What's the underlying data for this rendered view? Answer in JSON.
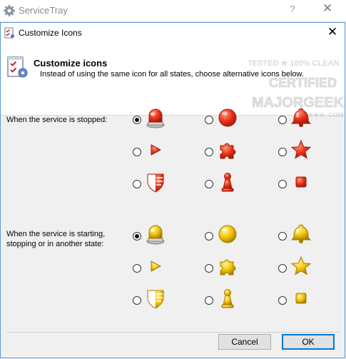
{
  "parent_window": {
    "title": "ServiceTray",
    "help_label": "?",
    "close_label": "✕"
  },
  "dialog": {
    "title": "Customize Icons",
    "close_label": "✕",
    "header": {
      "title": "Customize icons",
      "description": "Instead of using the same icon for all states, choose alternative icons below."
    },
    "groups": [
      {
        "label_lines": [
          "When the service is stopped:"
        ],
        "color": "red",
        "options": [
          {
            "icon": "beacon-light-icon",
            "selected": true
          },
          {
            "icon": "circle-icon",
            "selected": false
          },
          {
            "icon": "bell-icon",
            "selected": false
          },
          {
            "icon": "play-triangle-icon",
            "selected": false
          },
          {
            "icon": "puzzle-piece-icon",
            "selected": false
          },
          {
            "icon": "star-icon",
            "selected": false
          },
          {
            "icon": "shield-icon",
            "selected": false
          },
          {
            "icon": "pawn-icon",
            "selected": false
          },
          {
            "icon": "square-icon",
            "selected": false
          }
        ]
      },
      {
        "label_lines": [
          "When the service is starting,",
          "stopping or in another state:"
        ],
        "color": "yellow",
        "options": [
          {
            "icon": "beacon-light-icon",
            "selected": true
          },
          {
            "icon": "circle-icon",
            "selected": false
          },
          {
            "icon": "bell-icon",
            "selected": false
          },
          {
            "icon": "play-triangle-icon",
            "selected": false
          },
          {
            "icon": "puzzle-piece-icon",
            "selected": false
          },
          {
            "icon": "star-icon",
            "selected": false
          },
          {
            "icon": "shield-icon",
            "selected": false
          },
          {
            "icon": "pawn-icon",
            "selected": false
          },
          {
            "icon": "square-icon",
            "selected": false
          }
        ]
      }
    ],
    "buttons": {
      "cancel": "Cancel",
      "ok": "OK"
    }
  },
  "colors": {
    "red": {
      "base": "#e8321a",
      "light": "#ff9a7a",
      "dark": "#a51a0a"
    },
    "yellow": {
      "base": "#f2c200",
      "light": "#fff3a0",
      "dark": "#a67c00"
    },
    "accent": "#0078d7"
  }
}
